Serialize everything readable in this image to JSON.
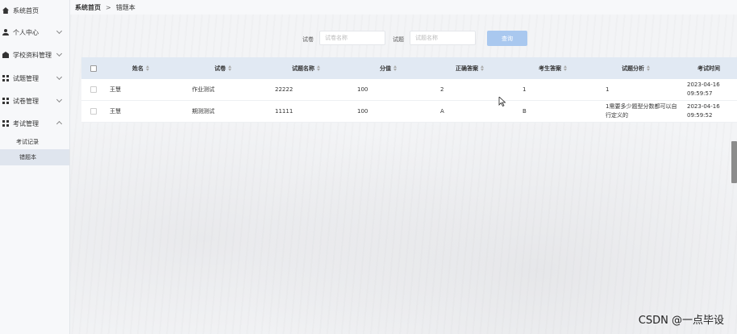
{
  "sidebar": {
    "items": [
      {
        "label": "系统首页",
        "icon": "home-icon"
      },
      {
        "label": "个人中心",
        "icon": "user-icon"
      },
      {
        "label": "学校资料管理",
        "icon": "school-icon"
      },
      {
        "label": "试题管理",
        "icon": "grid-icon"
      },
      {
        "label": "试卷管理",
        "icon": "grid-icon"
      },
      {
        "label": "考试管理",
        "icon": "grid-icon"
      }
    ],
    "subitems": [
      {
        "label": "考试记录"
      },
      {
        "label": "错题本"
      }
    ]
  },
  "breadcrumb": {
    "home": "系统首页",
    "separator": ">",
    "current": "错题本"
  },
  "search": {
    "paper_label": "试卷",
    "paper_placeholder": "试卷名称",
    "question_label": "试题",
    "question_placeholder": "试题名称",
    "query_label": "查询"
  },
  "table": {
    "headers": [
      "姓名",
      "试卷",
      "试题名称",
      "分值",
      "正确答案",
      "考生答案",
      "试题分析",
      "考试时间"
    ],
    "rows": [
      {
        "name": "王慧",
        "paper": "作业测试",
        "question": "22222",
        "score": "100",
        "correct": "2",
        "answer": "1",
        "analysis": "1",
        "time": "2023-04-16 09:59:57"
      },
      {
        "name": "王慧",
        "paper": "期测测试",
        "question": "11111",
        "score": "100",
        "correct": "A",
        "answer": "B",
        "analysis": "1需要多少题型分数都可以自行定义的",
        "time": "2023-04-16 09:59:52"
      }
    ]
  },
  "watermark": "CSDN @一点毕设"
}
